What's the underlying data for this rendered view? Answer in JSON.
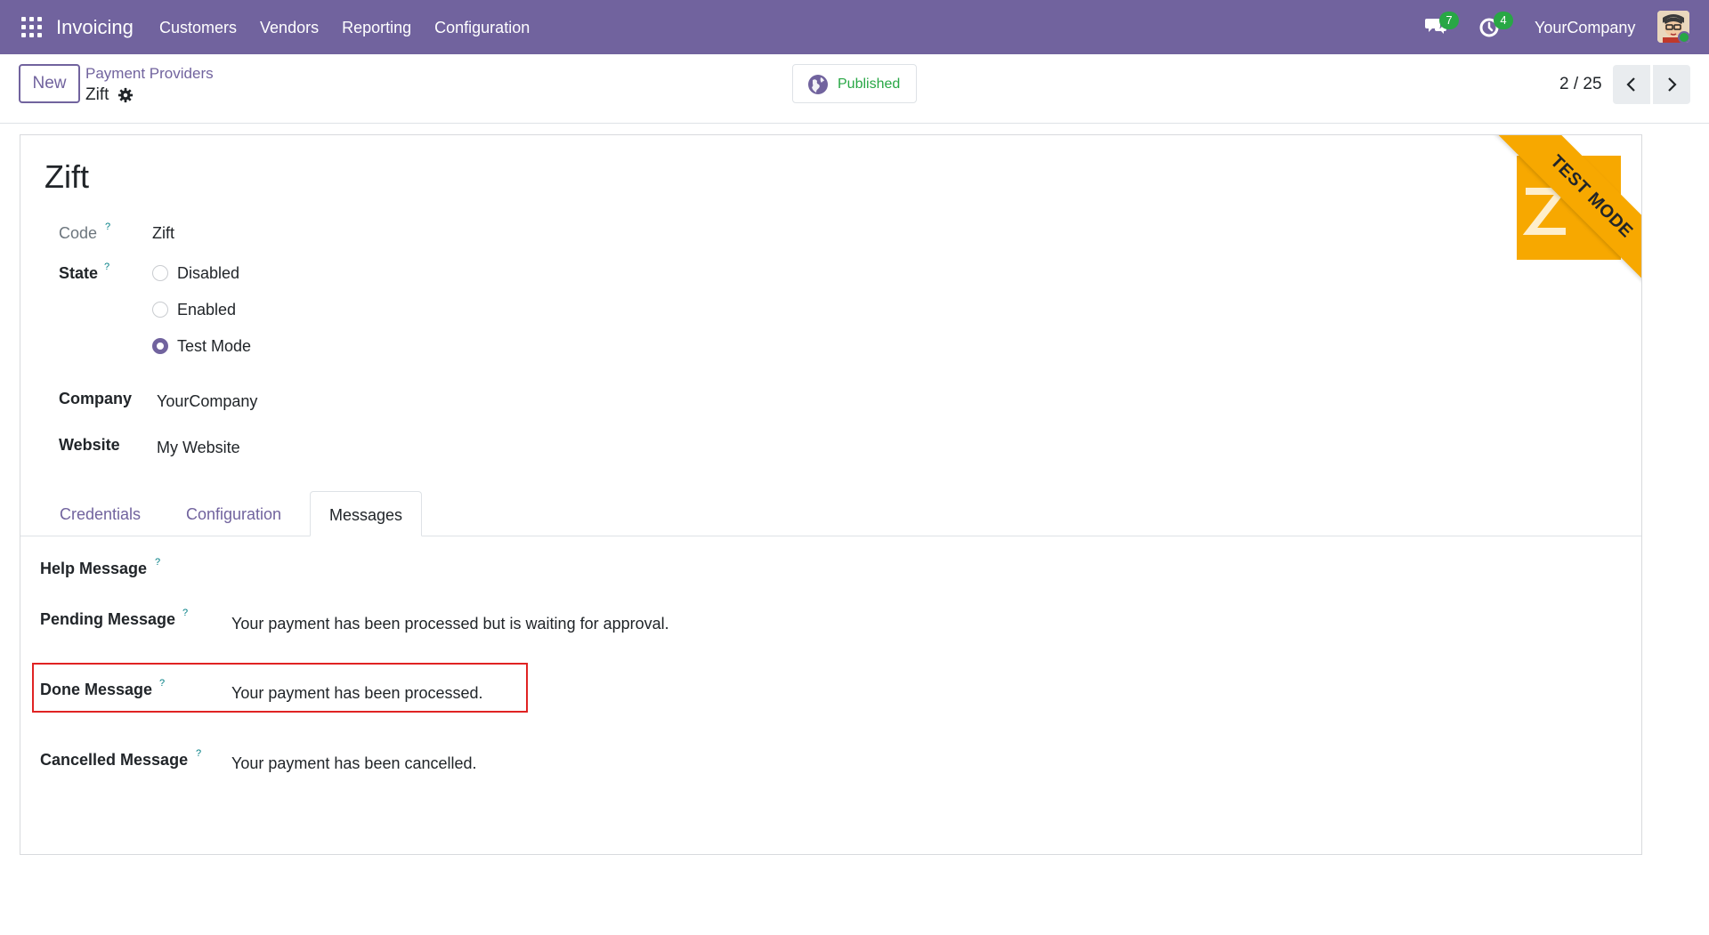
{
  "navbar": {
    "app_name": "Invoicing",
    "menu": [
      "Customers",
      "Vendors",
      "Reporting",
      "Configuration"
    ],
    "messages_count": "7",
    "activities_count": "4",
    "company": "YourCompany",
    "icons": {
      "apps": "apps-grid-icon",
      "messages": "chat-icon",
      "activities": "clock-icon",
      "avatar": "user-avatar"
    }
  },
  "control_panel": {
    "new_label": "New",
    "breadcrumb_parent": "Payment Providers",
    "breadcrumb_current": "Zift",
    "published_label": "Published",
    "pager": "2 / 25"
  },
  "form": {
    "title": "Zift",
    "ribbon": "TEST MODE",
    "code_label": "Code",
    "code_value": "Zift",
    "state_label": "State",
    "state_options": [
      "Disabled",
      "Enabled",
      "Test Mode"
    ],
    "state_selected": "Test Mode",
    "company_label": "Company",
    "company_value": "YourCompany",
    "website_label": "Website",
    "website_value": "My Website",
    "tooltip_mark": "?"
  },
  "tabs": [
    "Credentials",
    "Configuration",
    "Messages"
  ],
  "active_tab": "Messages",
  "messages": {
    "help_label": "Help Message",
    "help_value": "",
    "pending_label": "Pending Message",
    "pending_value": "Your payment has been processed but is waiting for approval.",
    "done_label": "Done Message",
    "done_value": "Your payment has been processed.",
    "cancelled_label": "Cancelled Message",
    "cancelled_value": "Your payment has been cancelled."
  },
  "colors": {
    "navbar": "#71639e",
    "accent": "#71639e",
    "success": "#28a745",
    "ribbon": "#f7a800",
    "highlight_border": "#e02323"
  }
}
